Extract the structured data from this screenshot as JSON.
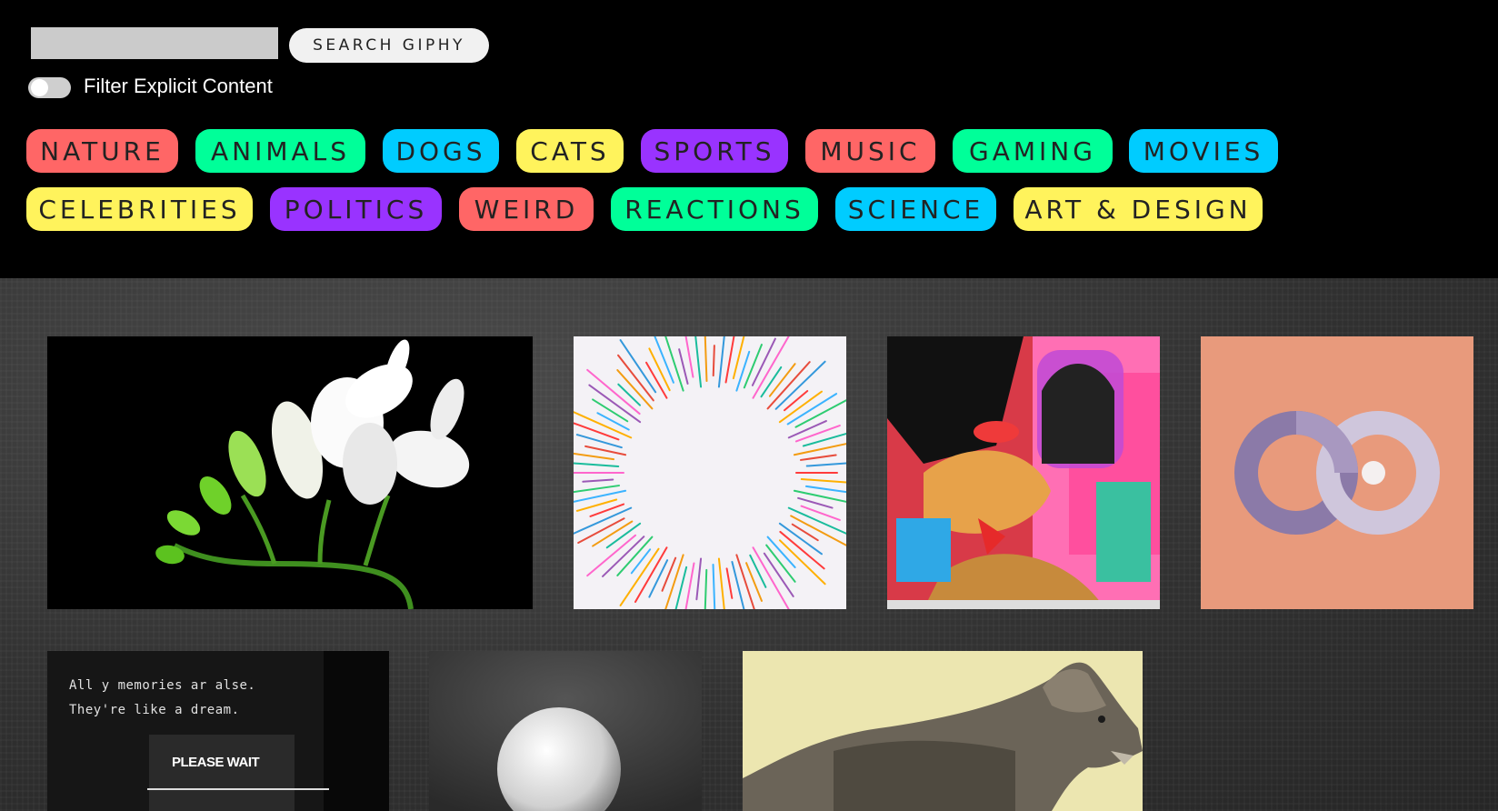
{
  "search": {
    "input_value": "",
    "input_placeholder": "",
    "button_label": "SEARCH GIPHY"
  },
  "filter": {
    "label": "Filter Explicit Content",
    "enabled": false
  },
  "tags": [
    {
      "label": "NATURE",
      "color": "#ff6666"
    },
    {
      "label": "ANIMALS",
      "color": "#00ff99"
    },
    {
      "label": "DOGS",
      "color": "#00ccff"
    },
    {
      "label": "CATS",
      "color": "#fff35c"
    },
    {
      "label": "SPORTS",
      "color": "#9933ff"
    },
    {
      "label": "MUSIC",
      "color": "#ff6666"
    },
    {
      "label": "GAMING",
      "color": "#00ff99"
    },
    {
      "label": "MOVIES",
      "color": "#00ccff"
    },
    {
      "label": "CELEBRITIES",
      "color": "#fff35c"
    },
    {
      "label": "POLITICS",
      "color": "#9933ff"
    },
    {
      "label": "WEIRD",
      "color": "#ff6666"
    },
    {
      "label": "REACTIONS",
      "color": "#00ff99"
    },
    {
      "label": "SCIENCE",
      "color": "#00ccff"
    },
    {
      "label": "ART & DESIGN",
      "color": "#fff35c"
    }
  ],
  "gifs": {
    "dream": {
      "line1": "All y  memories ar  alse.",
      "line2": "They're like a dream.",
      "please_wait": "PLEASE WAIT"
    }
  },
  "colors": {
    "header_bg": "#000000",
    "search_input_bg": "#cbcbcb",
    "search_button_bg": "#f1f1f1"
  }
}
